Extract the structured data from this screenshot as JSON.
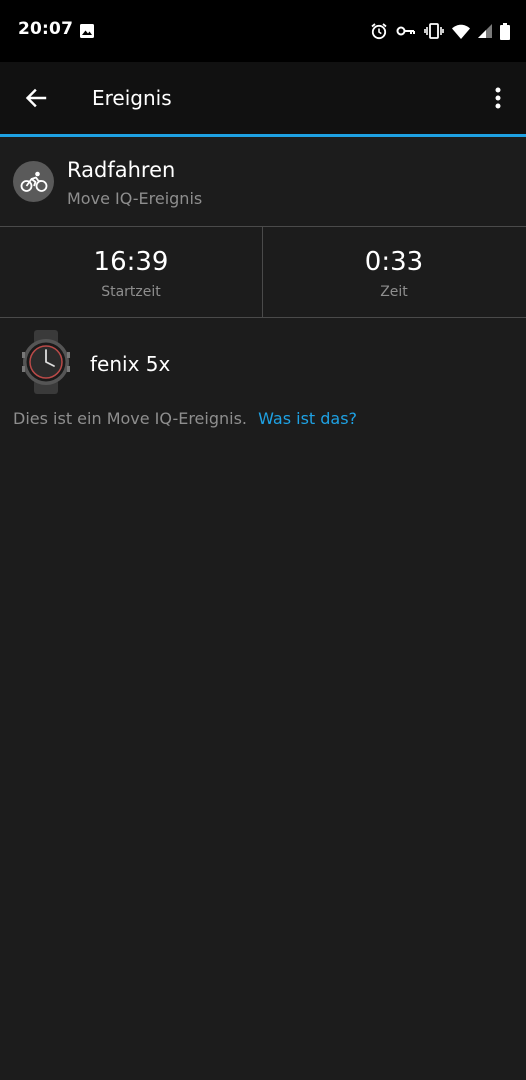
{
  "status_bar": {
    "time": "20:07",
    "icons": [
      "gallery-icon",
      "alarm-icon",
      "vpn-key-icon",
      "vibrate-icon",
      "wifi-icon",
      "cell-signal-icon",
      "battery-icon"
    ]
  },
  "app_bar": {
    "title": "Ereignis",
    "back_icon": "arrow-back-icon",
    "menu_icon": "more-vert-icon"
  },
  "colors": {
    "accent": "#1ea1e3",
    "background": "#1c1c1c",
    "app_bar": "#111111",
    "secondary_text": "#8e8e8e"
  },
  "activity": {
    "icon": "bicycle-icon",
    "title": "Radfahren",
    "subtitle": "Move IQ-Ereignis"
  },
  "stats": [
    {
      "value": "16:39",
      "label": "Startzeit"
    },
    {
      "value": "0:33",
      "label": "Zeit"
    }
  ],
  "device": {
    "name": "fenix 5x",
    "image": "watch-image"
  },
  "info": {
    "text": "Dies ist ein Move IQ-Ereignis.",
    "link": "Was ist das?"
  }
}
